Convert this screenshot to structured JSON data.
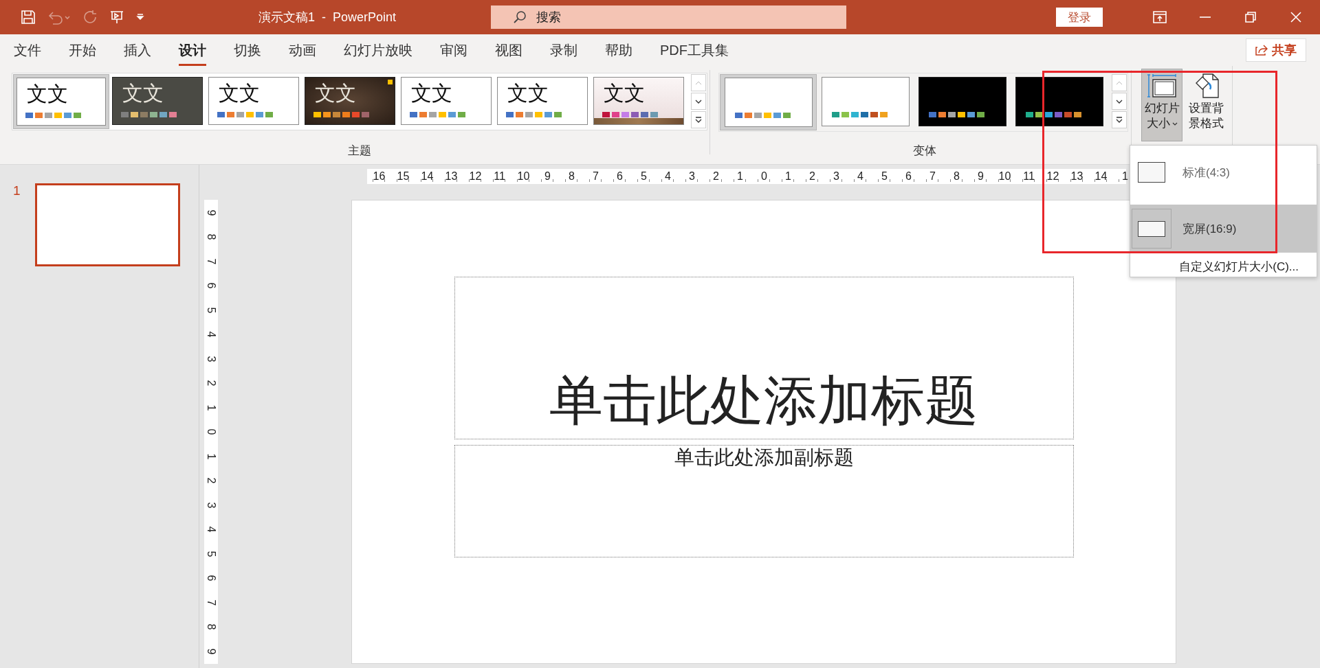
{
  "title_bar": {
    "quick_access": [
      {
        "kind": "save",
        "disabled": false
      },
      {
        "kind": "undo",
        "disabled": true
      },
      {
        "kind": "redo",
        "disabled": true
      },
      {
        "kind": "present",
        "disabled": false
      },
      {
        "kind": "customize",
        "disabled": false
      }
    ],
    "title": "演示文稿1  -  PowerPoint",
    "search": {
      "placeholder": "搜索"
    },
    "login_button": "登录",
    "window_controls": [
      {
        "kind": "ribbon-display"
      },
      {
        "kind": "minimize"
      },
      {
        "kind": "restore"
      },
      {
        "kind": "close"
      }
    ]
  },
  "tabs": [
    {
      "label": "文件",
      "selected": false
    },
    {
      "label": "开始",
      "selected": false
    },
    {
      "label": "插入",
      "selected": false
    },
    {
      "label": "设计",
      "selected": true
    },
    {
      "label": "切换",
      "selected": false
    },
    {
      "label": "动画",
      "selected": false
    },
    {
      "label": "幻灯片放映",
      "selected": false
    },
    {
      "label": "审阅",
      "selected": false
    },
    {
      "label": "视图",
      "selected": false
    },
    {
      "label": "录制",
      "selected": false
    },
    {
      "label": "帮助",
      "selected": false
    },
    {
      "label": "PDF工具集",
      "selected": false
    }
  ],
  "share_button": "共享",
  "ribbon": {
    "themes": {
      "label": "主题",
      "items": [
        {
          "kind": "light",
          "sample": "文文",
          "selected": true,
          "swatches": [
            {
              "color": "#4472c4"
            },
            {
              "color": "#ed7d31"
            },
            {
              "color": "#a5a5a5"
            },
            {
              "color": "#ffc000"
            },
            {
              "color": "#5b9bd5"
            },
            {
              "color": "#70ad47"
            }
          ]
        },
        {
          "kind": "dark",
          "sample": "文文",
          "selected": false,
          "swatches": [
            {
              "color": "#7f7f7f"
            },
            {
              "color": "#e4be6e"
            },
            {
              "color": "#8d7c63"
            },
            {
              "color": "#8eb491"
            },
            {
              "color": "#71a6c2"
            },
            {
              "color": "#e37f93"
            }
          ]
        },
        {
          "kind": "light",
          "sample": "文文",
          "selected": false,
          "swatches": [
            {
              "color": "#4472c4"
            },
            {
              "color": "#ed7d31"
            },
            {
              "color": "#a5a5a5"
            },
            {
              "color": "#ffc000"
            },
            {
              "color": "#5b9bd5"
            },
            {
              "color": "#70ad47"
            }
          ]
        },
        {
          "kind": "chalk",
          "sample": "文文",
          "selected": false,
          "swatches": [
            {
              "color": "#ffc000"
            },
            {
              "color": "#f7941d"
            },
            {
              "color": "#c8873a"
            },
            {
              "color": "#ee7d1c"
            },
            {
              "color": "#e8492a"
            },
            {
              "color": "#a0646a"
            }
          ]
        },
        {
          "kind": "light",
          "sample": "文文",
          "selected": false,
          "swatches": [
            {
              "color": "#4472c4"
            },
            {
              "color": "#ed7d31"
            },
            {
              "color": "#a5a5a5"
            },
            {
              "color": "#ffc000"
            },
            {
              "color": "#5b9bd5"
            },
            {
              "color": "#70ad47"
            }
          ]
        },
        {
          "kind": "light",
          "sample": "文文",
          "selected": false,
          "swatches": [
            {
              "color": "#4472c4"
            },
            {
              "color": "#ed7d31"
            },
            {
              "color": "#a5a5a5"
            },
            {
              "color": "#ffc000"
            },
            {
              "color": "#5b9bd5"
            },
            {
              "color": "#70ad47"
            }
          ]
        },
        {
          "kind": "photo",
          "sample": "文文",
          "selected": false,
          "swatches": [
            {
              "color": "#c0143c"
            },
            {
              "color": "#e0408a"
            },
            {
              "color": "#c47ce8"
            },
            {
              "color": "#8c5cb4"
            },
            {
              "color": "#5c6cb0"
            },
            {
              "color": "#6c9ab0"
            }
          ]
        }
      ]
    },
    "variants": {
      "label": "变体",
      "items": [
        {
          "kind": "light",
          "selected": true,
          "swatches": [
            {
              "color": "#4472c4"
            },
            {
              "color": "#ed7d31"
            },
            {
              "color": "#a5a5a5"
            },
            {
              "color": "#ffc000"
            },
            {
              "color": "#5b9bd5"
            },
            {
              "color": "#70ad47"
            }
          ]
        },
        {
          "kind": "light",
          "selected": false,
          "swatches": [
            {
              "color": "#1f9e89"
            },
            {
              "color": "#8bc34a"
            },
            {
              "color": "#2fb4d0"
            },
            {
              "color": "#1f6fa8"
            },
            {
              "color": "#c0501f"
            },
            {
              "color": "#f0a21e"
            }
          ]
        },
        {
          "kind": "dark",
          "selected": false,
          "swatches": [
            {
              "color": "#4472c4"
            },
            {
              "color": "#ed7d31"
            },
            {
              "color": "#a5a5a5"
            },
            {
              "color": "#ffc000"
            },
            {
              "color": "#5b9bd5"
            },
            {
              "color": "#70ad47"
            }
          ]
        },
        {
          "kind": "dark",
          "selected": false,
          "swatches": [
            {
              "color": "#1fae8c"
            },
            {
              "color": "#93c047"
            },
            {
              "color": "#2ba6d8"
            },
            {
              "color": "#7b5cc4"
            },
            {
              "color": "#c84c2a"
            },
            {
              "color": "#d9922e"
            }
          ]
        }
      ]
    },
    "slide_size_button": {
      "label": "幻灯片大小",
      "pressed": true
    },
    "format_background_button": {
      "label": "设置背景格式"
    }
  },
  "slide_size_menu": {
    "items": [
      {
        "kind": "standard",
        "label": "标准(4:3)",
        "selected": false
      },
      {
        "kind": "widescreen",
        "label": "宽屏(16:9)",
        "selected": true
      }
    ],
    "footer": "自定义幻灯片大小(C)..."
  },
  "slides_panel": [
    {
      "number": "1",
      "selected": true
    }
  ],
  "horizontal_ruler": [
    "16",
    "15",
    "14",
    "13",
    "12",
    "11",
    "10",
    "9",
    "8",
    "7",
    "6",
    "5",
    "4",
    "3",
    "2",
    "1",
    "0",
    "1",
    "2",
    "3",
    "4",
    "5",
    "6",
    "7",
    "8",
    "9",
    "10",
    "11",
    "12",
    "13",
    "14",
    "1"
  ],
  "vertical_ruler": [
    "9",
    "8",
    "7",
    "6",
    "5",
    "4",
    "3",
    "2",
    "1",
    "0",
    "1",
    "2",
    "3",
    "4",
    "5",
    "6",
    "7",
    "8",
    "9"
  ],
  "slide": {
    "title_placeholder": "单击此处添加标题",
    "subtitle_placeholder": "单击此处添加副标题"
  },
  "annotations": [
    {
      "kind": "frame",
      "color": "#e8262b"
    }
  ]
}
